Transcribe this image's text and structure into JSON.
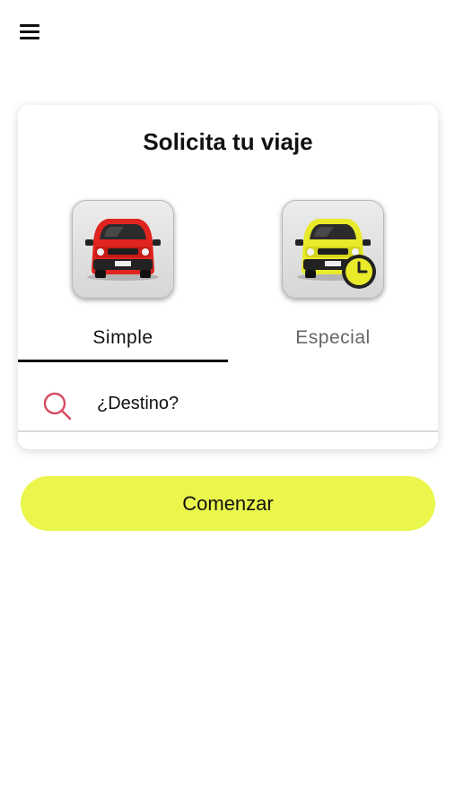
{
  "app": {
    "menu_icon": "hamburger-menu-icon"
  },
  "card": {
    "title": "Solicita tu viaje",
    "options": [
      {
        "label": "Simple",
        "icon": "red-van-icon",
        "selected": true,
        "color": "#e0241f"
      },
      {
        "label": "Especial",
        "icon": "yellow-van-clock-icon",
        "selected": false,
        "color": "#e8ea2a"
      }
    ],
    "search": {
      "placeholder": "¿Destino?",
      "icon": "search-icon",
      "icon_color": "#d64b63"
    }
  },
  "cta": {
    "label": "Comenzar",
    "color": "#eaf64b"
  }
}
